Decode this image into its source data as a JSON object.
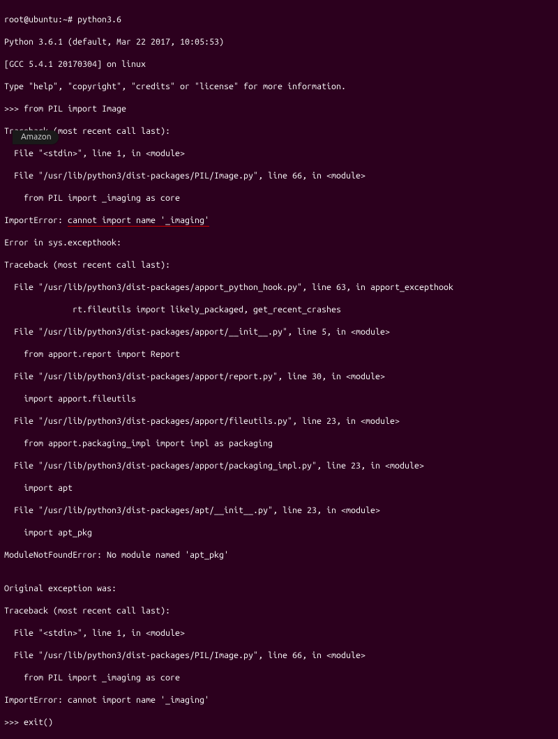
{
  "terminal": {
    "lines": [
      "root@ubuntu:~# python3.6",
      "Python 3.6.1 (default, Mar 22 2017, 10:05:53)",
      "[GCC 5.4.1 20170304] on linux",
      "Type \"help\", \"copyright\", \"credits\" or \"license\" for more information.",
      ">>> from PIL import Image",
      "Traceback (most recent call last):",
      "  File \"<stdin>\", line 1, in <module>",
      "  File \"/usr/lib/python3/dist-packages/PIL/Image.py\", line 66, in <module>",
      "    from PIL import _imaging as core",
      "ImportError: ",
      "cannot import name '_imaging'",
      "Error in sys.excepthook:",
      "Traceback (most recent call last):",
      "  File \"/usr/lib/python3/dist-packages/apport_python_hook.py\", line 63, in apport_excepthook",
      "",
      "rt.fileutils import likely_packaged, get_recent_crashes",
      "  File \"/usr/lib/python3/dist-packages/apport/__init__.py\", line 5, in <module>",
      "    from apport.report import Report",
      "  File \"/usr/lib/python3/dist-packages/apport/report.py\", line 30, in <module>",
      "    import apport.fileutils",
      "  File \"/usr/lib/python3/dist-packages/apport/fileutils.py\", line 23, in <module>",
      "    from apport.packaging_impl import impl as packaging",
      "  File \"/usr/lib/python3/dist-packages/apport/packaging_impl.py\", line 23, in <module>",
      "    import apt",
      "  File \"/usr/lib/python3/dist-packages/apt/__init__.py\", line 23, in <module>",
      "    import apt_pkg",
      "ModuleNotFoundError: No module named 'apt_pkg'",
      "",
      "Original exception was:",
      "Traceback (most recent call last):",
      "  File \"<stdin>\", line 1, in <module>",
      "  File \"/usr/lib/python3/dist-packages/PIL/Image.py\", line 66, in <module>",
      "    from PIL import _imaging as core",
      "ImportError: cannot import name '_imaging'",
      ">>> exit()"
    ]
  },
  "badge": {
    "label": "Amazon"
  }
}
